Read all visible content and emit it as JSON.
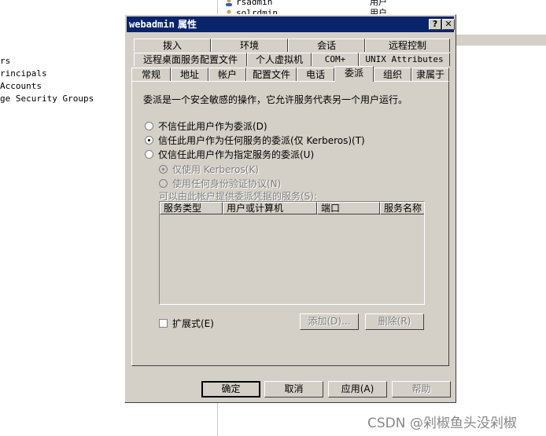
{
  "background": {
    "tree_items": [
      "rs",
      "rincipals",
      "Accounts",
      "ge Security Groups"
    ],
    "list_rows": [
      {
        "name": "rsadmin",
        "type": "用户"
      },
      {
        "name": "solrdmin",
        "type": "用户"
      }
    ]
  },
  "dialog": {
    "title_name": "webadmin",
    "title_suffix": " 属性",
    "help_button": "?",
    "close_button": "✕",
    "tabs_row1": [
      "拨入",
      "环境",
      "会话",
      "远程控制"
    ],
    "tabs_row2": [
      "远程桌面服务配置文件",
      "个人虚拟机",
      "COM+",
      "UNIX Attributes"
    ],
    "tabs_row3": [
      "常规",
      "地址",
      "帐户",
      "配置文件",
      "电话",
      "委派",
      "组织",
      "隶属于"
    ],
    "active_tab": "委派",
    "description": "委派是一个安全敏感的操作，它允许服务代表另一个用户运行。",
    "options": [
      {
        "label": "不信任此用户作为委派(D)",
        "checked": false
      },
      {
        "label": "信任此用户作为任何服务的委派(仅 Kerberos)(T)",
        "checked": true
      },
      {
        "label": "仅信任此用户作为指定服务的委派(U)",
        "checked": false
      }
    ],
    "sub_options": [
      {
        "label": "仅使用 Kerberos(K)",
        "checked": true
      },
      {
        "label": "使用任何身份验证协议(N)",
        "checked": false
      }
    ],
    "services_label": "可以由此帐户提供委派凭据的服务(S):",
    "columns": [
      "服务类型",
      "用户或计算机",
      "端口",
      "服务名称"
    ],
    "expand_label": "扩展式(E)",
    "add_button": "添加(D)...",
    "remove_button": "删除(R)",
    "ok_button": "确定",
    "cancel_button": "取消",
    "apply_button": "应用(A)",
    "help_bottom_button": "帮助"
  },
  "watermark": "CSDN @剁椒鱼头没剁椒"
}
